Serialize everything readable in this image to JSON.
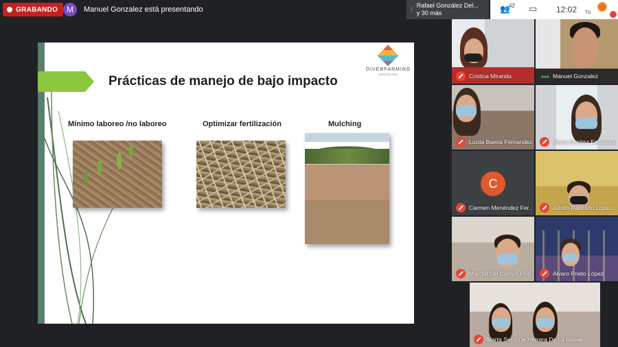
{
  "recording": {
    "label": "GRABANDO"
  },
  "presenter": {
    "avatar_letter": "M",
    "text": "Manuel Gonzalez está presentando"
  },
  "active_speaker": {
    "line1": "Rafael González Del...",
    "line2": "y 30 más"
  },
  "toolbar": {
    "participants_count": "42",
    "time": "12:02",
    "self_label": "Tú"
  },
  "slide": {
    "title": "Prácticas de manejo de bajo impacto",
    "brand_name": "DIVERFARMING",
    "brand_sub": "HORIZON 2020",
    "captions": [
      "Mínimo laboreo /no laboreo",
      "Optimizar fertilización",
      "Mulching"
    ]
  },
  "participants": [
    {
      "name": "Cristina Miranda",
      "muted": true
    },
    {
      "name": "Manuel Gonzalez",
      "muted": false
    },
    {
      "name": "Lucila Baena Fernandez",
      "muted": true
    },
    {
      "name": "Marta Benítez Escribano",
      "muted": true
    },
    {
      "name": "Carmen Menéndez Fer...",
      "muted": true,
      "avatar_letter": "C"
    },
    {
      "name": "Adolfo Rancaño López",
      "muted": true
    },
    {
      "name": "Marcial Del Campo Prie...",
      "muted": true
    },
    {
      "name": "Álvaro Prieto López",
      "muted": true
    },
    {
      "name": "Marta Seco De Herrera De La Rubia",
      "muted": true
    }
  ],
  "icons": [
    "record-dot-icon",
    "people-icon",
    "chat-icon",
    "mic-off-icon",
    "speaker-icon"
  ],
  "colors": {
    "recording": "#c5221f",
    "mic_muted": "#ea4335",
    "arrow": "#8dc63f",
    "avatar_c": "#e0582d"
  }
}
